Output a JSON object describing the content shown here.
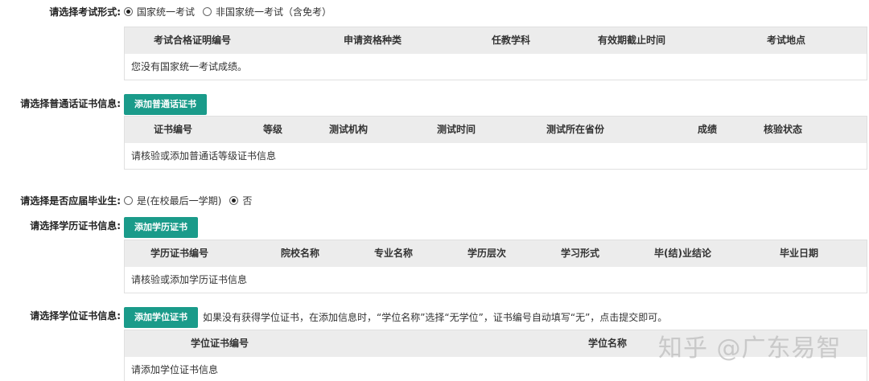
{
  "exam": {
    "label": "请选择考试形式:",
    "options": [
      "国家统一考试",
      "非国家统一考试（含免考）"
    ],
    "selected": 0,
    "headers": [
      "考试合格证明编号",
      "申请资格种类",
      "任教学科",
      "有效期截止时间",
      "考试地点"
    ],
    "empty_text": "您没有国家统一考试成绩。"
  },
  "mandarin": {
    "label": "请选择普通话证书信息:",
    "button": "添加普通话证书",
    "headers": [
      "证书编号",
      "等级",
      "测试机构",
      "测试时间",
      "测试所在省份",
      "成绩",
      "核验状态"
    ],
    "empty_text": "请核验或添加普通话等级证书信息"
  },
  "graduate": {
    "label": "请选择是否应届毕业生:",
    "options": [
      "是(在校最后一学期)",
      "否"
    ],
    "selected": 1
  },
  "education": {
    "label": "请选择学历证书信息:",
    "button": "添加学历证书",
    "headers": [
      "学历证书编号",
      "院校名称",
      "专业名称",
      "学历层次",
      "学习形式",
      "毕(结)业结论",
      "毕业日期"
    ],
    "empty_text": "请核验或添加学历证书信息"
  },
  "degree": {
    "label": "请选择学位证书信息:",
    "button": "添加学位证书",
    "note": "如果没有获得学位证书，在添加信息时，“学位名称”选择“无学位”，证书编号自动填写“无”，点击提交即可。",
    "headers": [
      "学位证书编号",
      "学位名称"
    ],
    "empty_text": "请添加学位证书信息"
  },
  "watermark": "知乎 @广东易智"
}
